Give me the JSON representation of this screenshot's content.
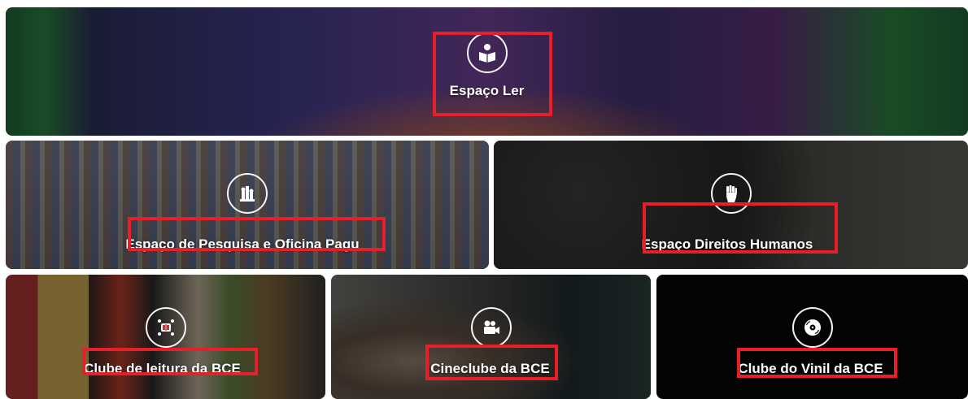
{
  "tiles": [
    {
      "label": "Espaço Ler",
      "icon": "reading-icon"
    },
    {
      "label": "Espaço de Pesquisa e Oficina Pagu",
      "icon": "chess-pieces-icon"
    },
    {
      "label": "Espaço Direitos Humanos",
      "icon": "raised-fist-icon"
    },
    {
      "label": "Clube de leitura da BCE",
      "icon": "book-club-icon"
    },
    {
      "label": "Cineclube da BCE",
      "icon": "video-camera-icon"
    },
    {
      "label": "Clube do Vinil da BCE",
      "icon": "vinyl-record-icon"
    }
  ],
  "highlight_color": "#e5202a"
}
